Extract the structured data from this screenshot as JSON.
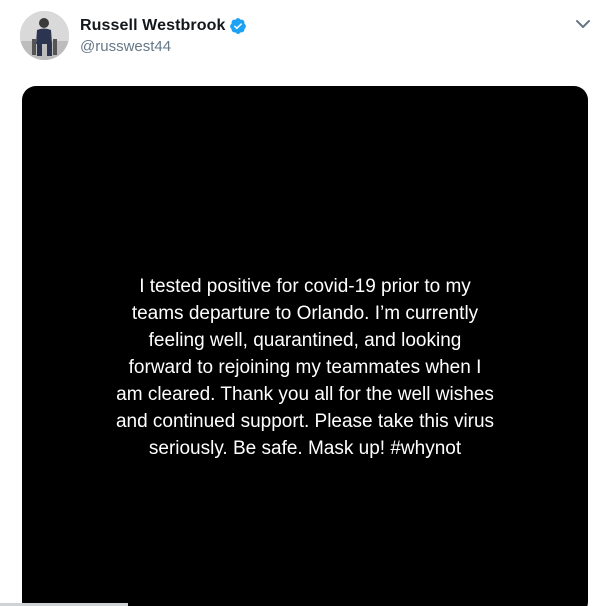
{
  "author": {
    "display_name": "Russell Westbrook",
    "handle": "@russwest44",
    "verified": true,
    "avatar_icon": "profile-photo"
  },
  "menu": {
    "icon": "chevron-down-icon"
  },
  "media": {
    "background": "#000000",
    "text_color": "#ffffff",
    "lines": [
      "I tested positive for covid-19 prior to my",
      "teams departure to Orlando. I’m currently",
      "feeling well, quarantined, and looking",
      "forward to rejoining my teammates when I",
      "am cleared. Thank you all for the well wishes",
      "and continued support. Please take this virus",
      "seriously. Be safe. Mask up! #whynot"
    ]
  },
  "colors": {
    "verified_badge": "#1da1f2",
    "handle": "#657786",
    "name": "#14171a"
  }
}
